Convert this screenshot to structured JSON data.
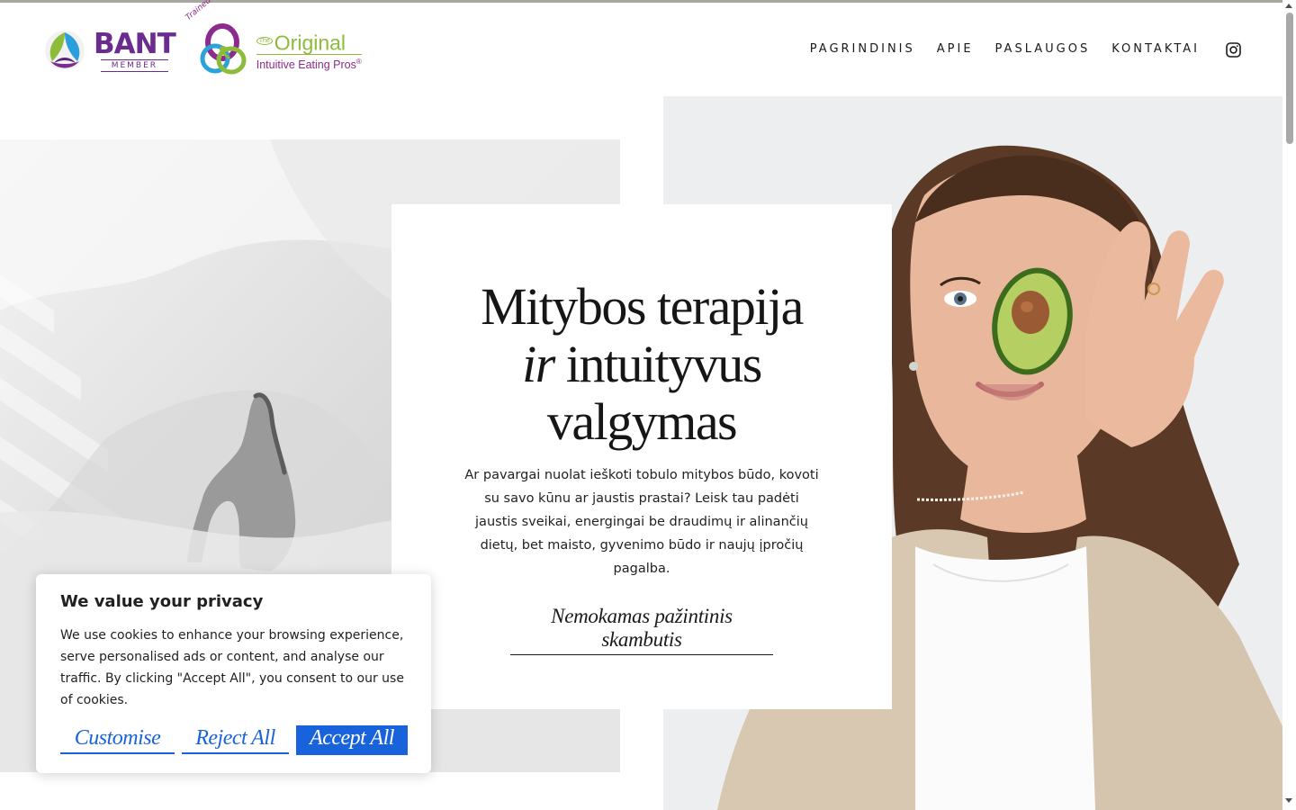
{
  "header": {
    "bant_logo": {
      "name": "BANT",
      "sub": "MEMBER"
    },
    "iep_logo": {
      "trained": "Trained & Certified by",
      "the": "The",
      "original": "Original",
      "sub": "Intuitive Eating Pros",
      "reg": "®"
    },
    "nav": [
      {
        "label": "PAGRINDINIS"
      },
      {
        "label": "APIE"
      },
      {
        "label": "PASLAUGOS"
      },
      {
        "label": "KONTAKTAI"
      }
    ],
    "social_icon": "instagram-icon"
  },
  "hero": {
    "title_line1": "Mitybos terapija",
    "title_ir": "ir",
    "title_line2_rest": " intuityvus",
    "title_line3": "valgymas",
    "body": "Ar pavargai nuolat ieškoti tobulo mitybos būdo, kovoti su savo kūnu ar jaustis prastai? Leisk tau padėti jaustis sveikai, energingai be draudimų ir alinančių dietų, bet maisto, gyvenimo būdo ir naujų įpročių pagalba.",
    "cta": "Nemokamas pažintinis skambutis"
  },
  "cookie_banner": {
    "title": "We value your privacy",
    "text": "We use cookies to enhance your browsing experience, serve personalised ads or content, and analyse our traffic. By clicking \"Accept All\", you consent to our use of cookies.",
    "customise": "Customise",
    "reject": "Reject All",
    "accept": "Accept All",
    "accent_color": "#1863dc"
  }
}
